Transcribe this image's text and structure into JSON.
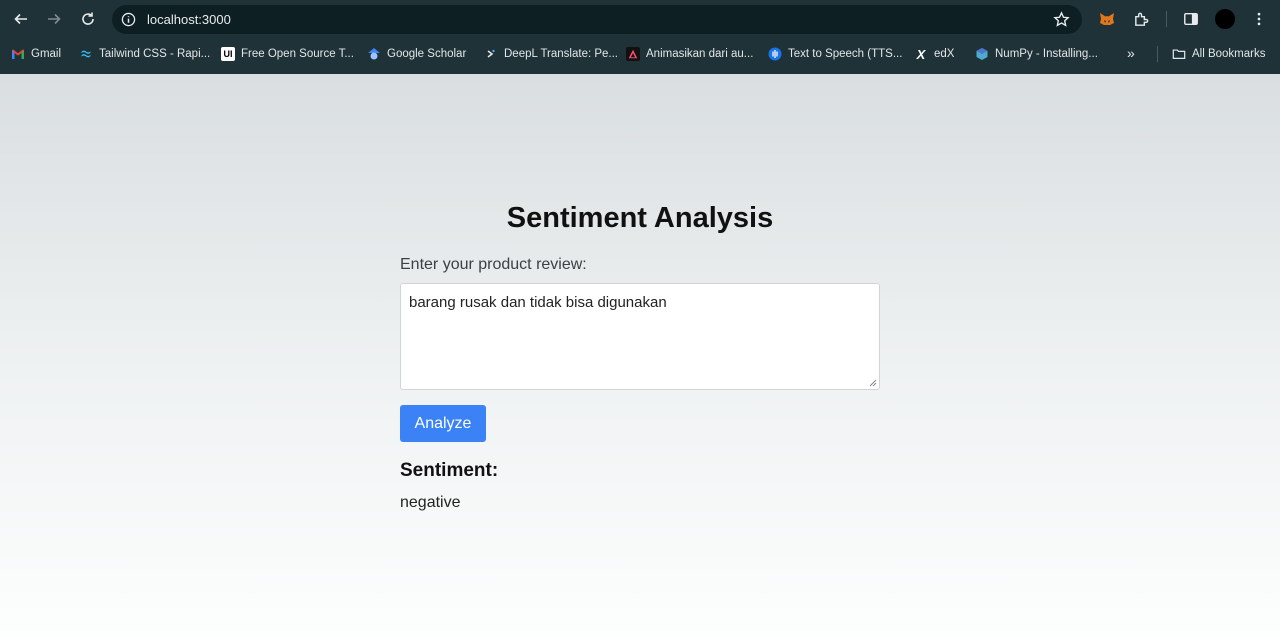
{
  "browser": {
    "url": "localhost:3000",
    "bookmarks": [
      {
        "label": "Gmail",
        "icon": "gmail-icon"
      },
      {
        "label": "Tailwind CSS - Rapi...",
        "icon": "tailwind-icon"
      },
      {
        "label": "Free Open Source T...",
        "icon": "ui-icon"
      },
      {
        "label": "Google Scholar",
        "icon": "scholar-icon"
      },
      {
        "label": "DeepL Translate: Pe...",
        "icon": "deepl-icon"
      },
      {
        "label": "Animasikan dari au...",
        "icon": "animate-icon"
      },
      {
        "label": "Text to Speech (TTS...",
        "icon": "tts-icon"
      },
      {
        "label": "edX",
        "icon": "edx-icon"
      },
      {
        "label": "NumPy - Installing...",
        "icon": "numpy-icon"
      }
    ],
    "more_bookmarks": "»",
    "all_bookmarks": "All Bookmarks"
  },
  "page": {
    "title": "Sentiment Analysis",
    "review_label": "Enter your product review:",
    "review_value": "barang rusak dan tidak bisa digunakan",
    "analyze_label": "Analyze",
    "result_title": "Sentiment:",
    "result_value": "negative"
  },
  "colors": {
    "chrome_bg": "#1f3237",
    "button": "#3b82f6"
  }
}
